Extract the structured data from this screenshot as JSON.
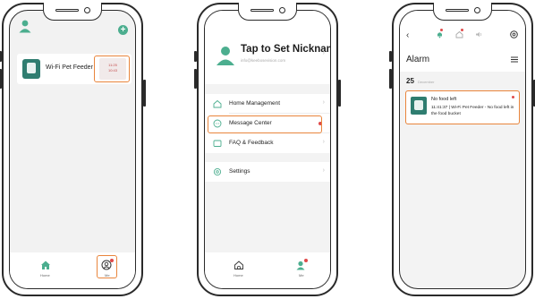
{
  "phone1": {
    "device_name": "Wi-Fi Pet Feeder",
    "device_tag": [
      "11:25",
      "10:43"
    ],
    "tabs": [
      {
        "label": "Home",
        "icon": "home-icon"
      },
      {
        "label": "Me",
        "icon": "me-icon"
      }
    ]
  },
  "phone2": {
    "nickname": "Tap to Set Nickname",
    "email": "info@keebosevision.com",
    "menu": [
      {
        "label": "Home Management",
        "icon": "home-outline-icon"
      },
      {
        "label": "Message Center",
        "icon": "message-icon"
      },
      {
        "label": "FAQ & Feedback",
        "icon": "faq-icon"
      },
      {
        "label": "Settings",
        "icon": "settings-icon"
      }
    ],
    "tabs": [
      {
        "label": "Home",
        "icon": "home-outline-icon"
      },
      {
        "label": "Me",
        "icon": "me-icon"
      }
    ]
  },
  "phone3": {
    "title": "Alarm",
    "date_day": "25",
    "date_month": "December",
    "alarm": {
      "title": "No food left",
      "detail": "11:41:37 | Wi-Fi Pet Feeder - No food left in the food bucket"
    }
  },
  "colors": {
    "accent_green": "#4cae8f",
    "highlight_orange": "#e9853c",
    "badge_red": "#e04a4a"
  }
}
